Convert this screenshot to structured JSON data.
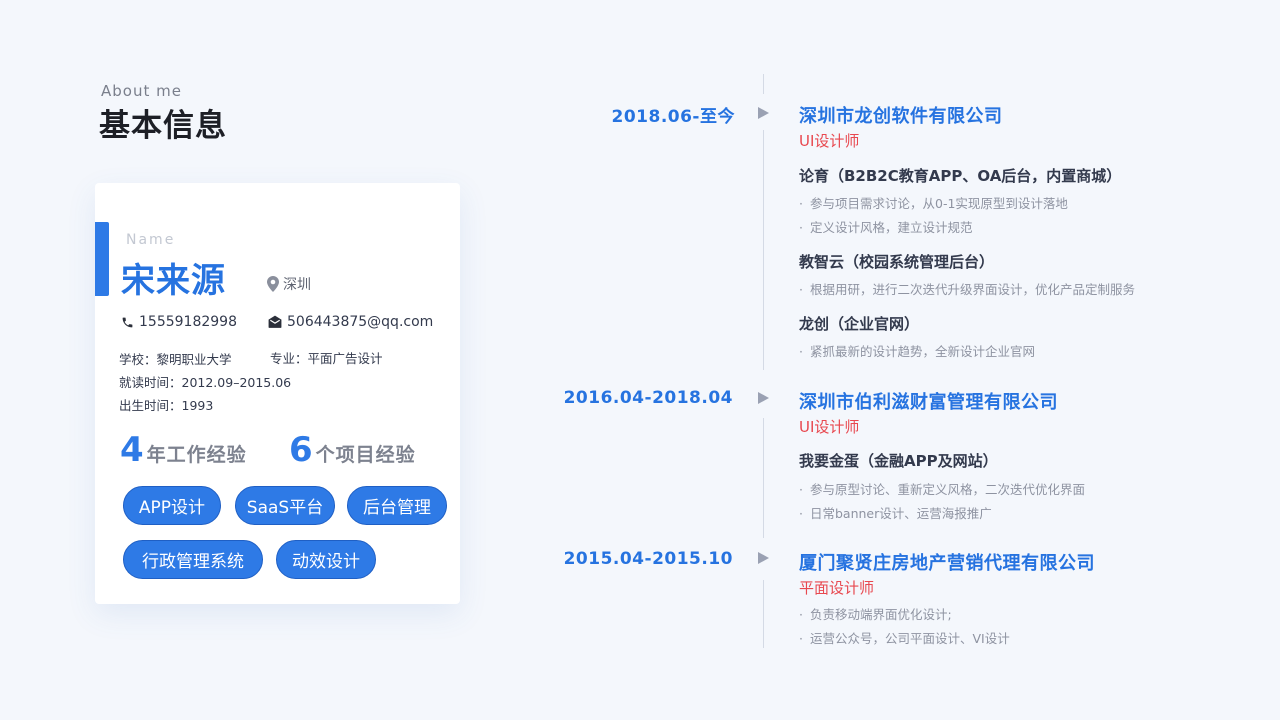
{
  "header": {
    "subtitle": "About  me",
    "title": "基本信息"
  },
  "profile": {
    "name_label": "Name",
    "name": "宋来源",
    "city": "深圳",
    "phone": "15559182998",
    "email": "506443875@qq.com",
    "school": "学校：黎明职业大学",
    "major": "专业：平面广告设计",
    "study_period": "就读时间：2012.09–2015.06",
    "birth": "出生时间：1993",
    "years_num": "4",
    "years_text": "年工作经验",
    "projects_num": "6",
    "projects_text": "个项目经验",
    "tags": [
      "APP设计",
      "SaaS平台",
      "后台管理",
      "行政管理系统",
      "动效设计"
    ]
  },
  "timeline": [
    {
      "date": "2018.06-至今",
      "company": "深圳市龙创软件有限公司",
      "role": "UI设计师",
      "projects": [
        {
          "title": "论育（B2B2C教育APP、OA后台，内置商城）",
          "bullets": [
            "参与项目需求讨论，从0-1实现原型到设计落地",
            "定义设计风格，建立设计规范"
          ]
        },
        {
          "title": "教智云（校园系统管理后台）",
          "bullets": [
            "根据用研，进行二次迭代升级界面设计，优化产品定制服务"
          ]
        },
        {
          "title": "龙创（企业官网）",
          "bullets": [
            "紧抓最新的设计趋势，全新设计企业官网"
          ]
        }
      ]
    },
    {
      "date": "2016.04-2018.04",
      "company": "深圳市伯利滋财富管理有限公司",
      "role": "UI设计师",
      "projects": [
        {
          "title": "我要金蛋（金融APP及网站）",
          "bullets": [
            "参与原型讨论、重新定义风格，二次迭代优化界面",
            "日常banner设计、运营海报推广"
          ]
        }
      ]
    },
    {
      "date": "2015.04-2015.10",
      "company": "厦门聚贤庄房地产营销代理有限公司",
      "role": "平面设计师",
      "bullets": [
        "负责移动端界面优化设计;",
        "运营公众号，公司平面设计、VI设计"
      ]
    }
  ],
  "bullet_mark": "·",
  "colors": {
    "accent": "#2e7ae6",
    "role": "#e8484f",
    "background": "#f4f7fc"
  },
  "icons": {
    "city": "map-pin-icon",
    "phone": "phone-icon",
    "email": "mail-icon",
    "timeline": "triangle-right-icon"
  }
}
